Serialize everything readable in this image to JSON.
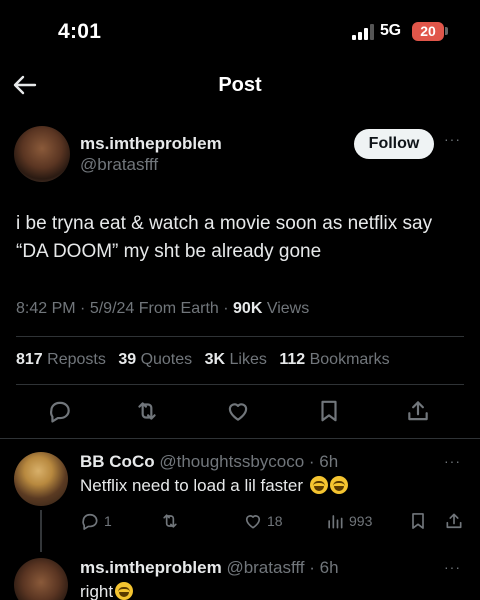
{
  "status_bar": {
    "time": "4:01",
    "network": "5G",
    "battery": "20"
  },
  "header": {
    "title": "Post",
    "back_icon": "arrow-left-icon"
  },
  "post": {
    "author": {
      "name": "ms.imtheproblem",
      "handle": "@bratasfff"
    },
    "follow_label": "Follow",
    "more_label": "···",
    "text": "i be tryna eat & watch a movie soon as netflix say “DA DOOM” my sht be already gone",
    "meta": {
      "time": "8:42 PM",
      "date": "5/9/24",
      "source": "From Earth",
      "views_count": "90K",
      "views_label": "Views"
    },
    "stats": [
      {
        "count": "817",
        "label": "Reposts"
      },
      {
        "count": "39",
        "label": "Quotes"
      },
      {
        "count": "3K",
        "label": "Likes"
      },
      {
        "count": "112",
        "label": "Bookmarks"
      }
    ],
    "actions": [
      "reply-icon",
      "repost-icon",
      "like-icon",
      "bookmark-icon",
      "share-icon"
    ]
  },
  "replies": [
    {
      "name": "BB CoCo",
      "handle": "@thoughtssbycoco",
      "sep": " · ",
      "time": "6h",
      "text": "Netflix need to load a lil faster",
      "more_label": "···",
      "reply_count": "1",
      "like_count": "18",
      "views_count": "993"
    },
    {
      "name": "ms.imtheproblem",
      "handle": "@bratasfff",
      "sep": " · ",
      "time": "6h",
      "text": "right",
      "more_label": "···"
    }
  ],
  "colors": {
    "background": "#000000",
    "text_primary": "#e7e9ea",
    "text_secondary": "#71767b",
    "divider": "#2f3336",
    "battery": "#e0564a"
  }
}
